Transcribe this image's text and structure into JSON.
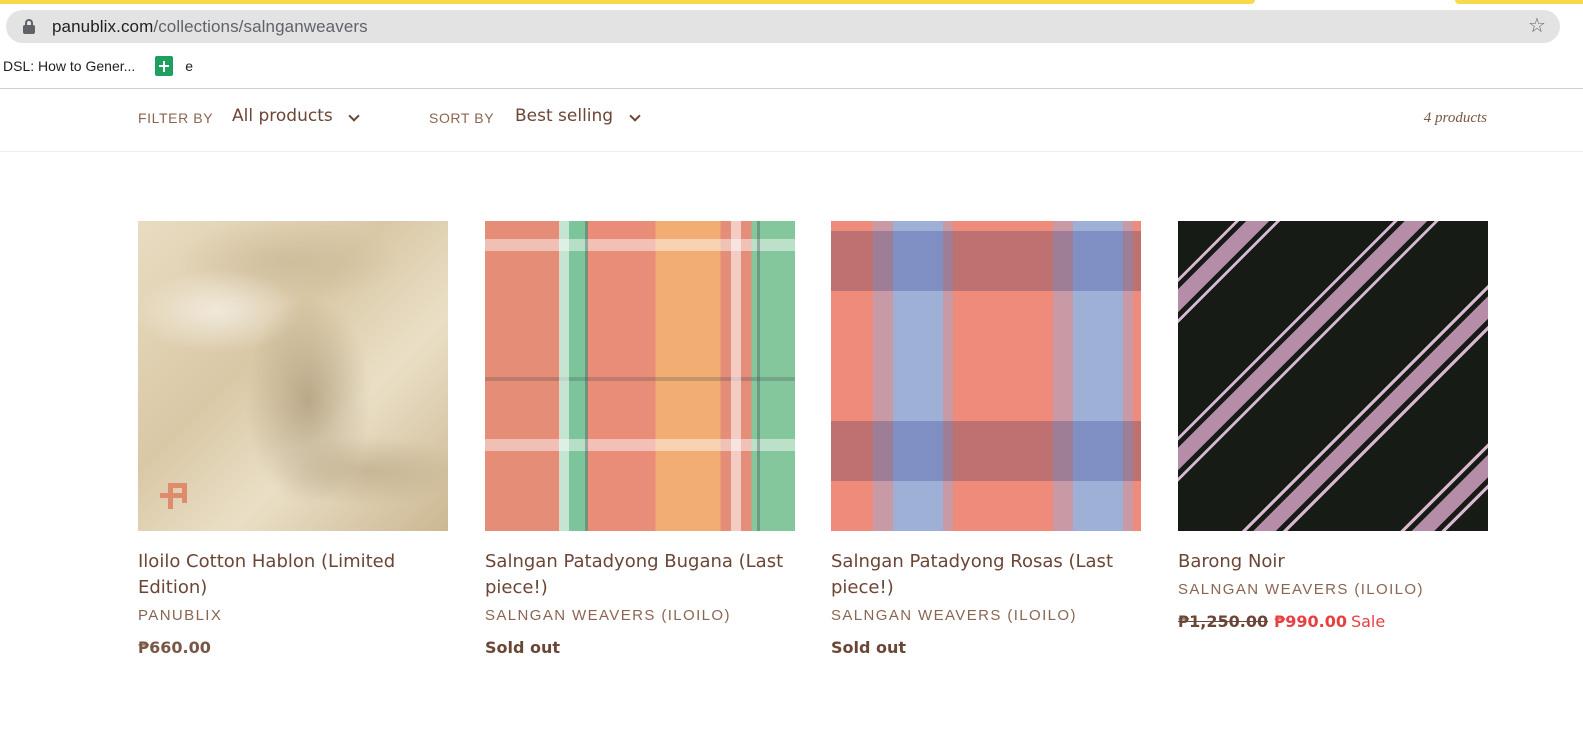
{
  "browser": {
    "url_host": "panublix.com",
    "url_path": "/collections/salnganweavers",
    "bookmarks": [
      {
        "label": "DSL: How to Gener..."
      },
      {
        "label": "e"
      }
    ]
  },
  "filters": {
    "filter_label": "FILTER BY",
    "filter_value": "All products",
    "sort_label": "SORT BY",
    "sort_value": "Best selling",
    "product_count": "4 products"
  },
  "products": [
    {
      "title": "Iloilo Cotton Hablon (Limited Edition)",
      "vendor": "PANUBLIX",
      "price": "₱660.00",
      "image": "cream-cotton-fabric"
    },
    {
      "title": "Salngan Patadyong Bugana (Last piece!)",
      "vendor": "SALNGAN WEAVERS (ILOILO)",
      "price": "Sold out",
      "image": "plaid-patadyong-fabric"
    },
    {
      "title": "Salngan Patadyong Rosas (Last piece!)",
      "vendor": "SALNGAN WEAVERS (ILOILO)",
      "price": "Sold out",
      "image": "pink-blue-check-fabric"
    },
    {
      "title": "Barong Noir",
      "vendor": "SALNGAN WEAVERS (ILOILO)",
      "price_old": "₱1,250.00",
      "price_sale": "₱990.00",
      "sale_tag": "Sale",
      "image": "black-diagonal-pattern-fabric"
    }
  ],
  "colors": {
    "text_brown": "#6b4636",
    "sale_red": "#e84040",
    "loading_bar": "#f9d94c"
  }
}
